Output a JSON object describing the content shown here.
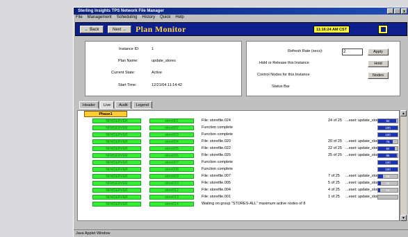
{
  "window": {
    "title": "Sterling Insights TPS Network File Manager",
    "controls": [
      "_",
      "□",
      "x"
    ]
  },
  "menu": [
    "File",
    "Management",
    "Scheduling",
    "History",
    "Quick",
    "Help"
  ],
  "toolbar": {
    "back_label": "← Back",
    "next_label": "Next →",
    "title": "Plan Monitor",
    "clock": "11:16:24 AM CST"
  },
  "info": {
    "instance_id_label": "Instance ID:",
    "instance_id": "1",
    "plan_name_label": "Plan Name:",
    "plan_name": "update_stores",
    "current_state_label": "Current State:",
    "current_state": "Active",
    "start_time_label": "Start Time:",
    "start_time": "12/21/04 11:14:42"
  },
  "controls": {
    "refresh_label": "Refresh Rate (secs):",
    "refresh_value": "2",
    "apply_label": "Apply",
    "hold_label_text": "Hold or Release this Instance",
    "hold_button": "Hold",
    "nodes_label_text": "Control Nodes for this Instance",
    "nodes_button": "Nodes",
    "status_bar_label": "Status Bar"
  },
  "tabs": [
    "Header",
    "Live",
    "Audit",
    "Legend"
  ],
  "phase_label": "Phase1",
  "rows": [
    {
      "server": "NFMSERVER",
      "node": "store001",
      "msg": "File: storefile.024",
      "count": "24 of 25",
      "eset": "...eset: update_stores",
      "pct": "92"
    },
    {
      "server": "NFMSERVER",
      "node": "store002",
      "msg": "Function complete",
      "count": "",
      "eset": "",
      "pct": "100"
    },
    {
      "server": "NFMSERVER",
      "node": "store003",
      "msg": "Function complete",
      "count": "",
      "eset": "",
      "pct": "100"
    },
    {
      "server": "NFMSERVER",
      "node": "store004",
      "msg": "File: storefile.020",
      "count": "20 of 25",
      "eset": "...eset: update_stores",
      "pct": "76"
    },
    {
      "server": "NFMSERVER",
      "node": "store005",
      "msg": "File: storefile.022",
      "count": "22 of 25",
      "eset": "...eset: update_stores",
      "pct": "84"
    },
    {
      "server": "NFMSERVER",
      "node": "store006",
      "msg": "File: storefile.025",
      "count": "25 of 25",
      "eset": "...eset: update_stores",
      "pct": "96"
    },
    {
      "server": "NFMSERVER",
      "node": "store007",
      "msg": "Function complete",
      "count": "",
      "eset": "",
      "pct": "100"
    },
    {
      "server": "NFMSERVER",
      "node": "store008",
      "msg": "Function complete",
      "count": "",
      "eset": "",
      "pct": "100"
    },
    {
      "server": "NFMSERVER",
      "node": "store009",
      "msg": "File: storefile.007",
      "count": "7 of 25",
      "eset": "...eset: update_stores",
      "pct": "24"
    },
    {
      "server": "NFMSERVER",
      "node": "store010",
      "msg": "File: storefile.005",
      "count": "5 of 25",
      "eset": "...eset: update_stores",
      "pct": "16"
    },
    {
      "server": "NFMSERVER",
      "node": "store012",
      "msg": "File: storefile.004",
      "count": "4 of 25",
      "eset": "...eset: update_stores",
      "pct": "12"
    },
    {
      "server": "NFMSERVER",
      "node": "store013",
      "msg": "File: storefile.001",
      "count": "1 of 25",
      "eset": "...eset: update_stores",
      "pct": ""
    },
    {
      "server": "NFMSERVER",
      "node": "store014",
      "msg": "Waiting on group \"STORES-ALL\" maximum active nodes of 8",
      "count": "",
      "eset": "",
      "pct": ""
    }
  ],
  "status_text": "Java Applet Window",
  "colors": {
    "toolbar_bg": "#0d1f8c",
    "title_fg": "#ffd24a",
    "clock_bg": "#ffff33",
    "node_green": "#33ee33",
    "phase_bg": "#ffcc33",
    "progress_fill": "#1a32b8"
  }
}
